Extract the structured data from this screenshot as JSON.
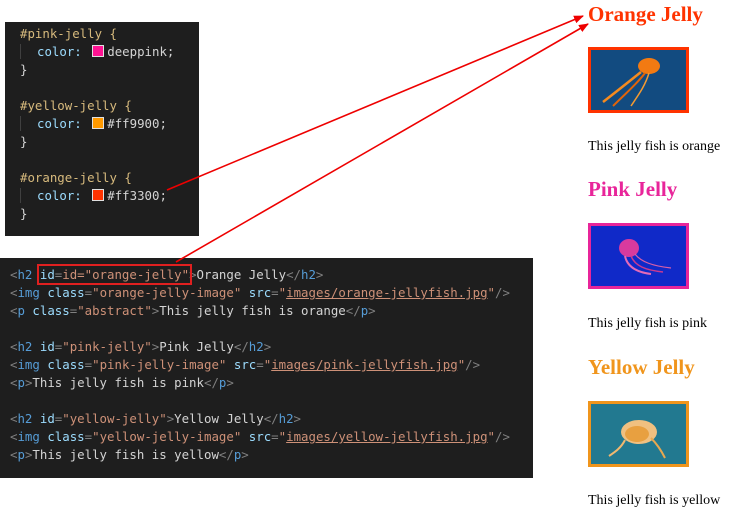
{
  "css_code": {
    "rules": [
      {
        "selector": "#pink-jelly {",
        "property": "color:",
        "value": "deeppink;",
        "swatch": "#ff1493",
        "close": "}"
      },
      {
        "selector": "#yellow-jelly {",
        "property": "color:",
        "value": "#ff9900;",
        "swatch": "#ff9900",
        "close": "}"
      },
      {
        "selector": "#orange-jelly {",
        "property": "color:",
        "value": "#ff3300;",
        "swatch": "#ff3300",
        "close": "}"
      }
    ]
  },
  "html_code": {
    "h2_orange": {
      "attr": "id=\"orange-jelly\"",
      "text": "Orange Jelly"
    },
    "img_orange": {
      "class": "\"orange-jelly-image\"",
      "src": "images/orange-jellyfish.jpg"
    },
    "p_orange": {
      "class": "\"abstract\"",
      "text": "This jelly fish is orange"
    },
    "h2_pink": {
      "id": "\"pink-jelly\"",
      "text": "Pink Jelly"
    },
    "img_pink": {
      "class": "\"pink-jelly-image\"",
      "src": "images/pink-jellyfish.jpg"
    },
    "p_pink": {
      "text": "This jelly fish is pink"
    },
    "h2_yellow": {
      "id": "\"yellow-jelly\"",
      "text": "Yellow Jelly"
    },
    "img_yellow": {
      "class": "\"yellow-jelly-image\"",
      "src": "images/yellow-jellyfish.jpg"
    },
    "p_yellow": {
      "text": "This jelly fish is yellow"
    }
  },
  "rendered": {
    "orange": {
      "heading": "Orange Jelly",
      "caption": "This jelly fish is orange",
      "color": "#ff3300"
    },
    "pink": {
      "heading": "Pink Jelly",
      "caption": "This jelly fish is pink",
      "color": "#e8259a"
    },
    "yellow": {
      "heading": "Yellow Jelly",
      "caption": "This jelly fish is yellow",
      "color": "#f0951c"
    }
  },
  "colors": {
    "arrow": "#ee0000",
    "highlight": "#e02020",
    "editor_bg": "#1e1e1e"
  }
}
